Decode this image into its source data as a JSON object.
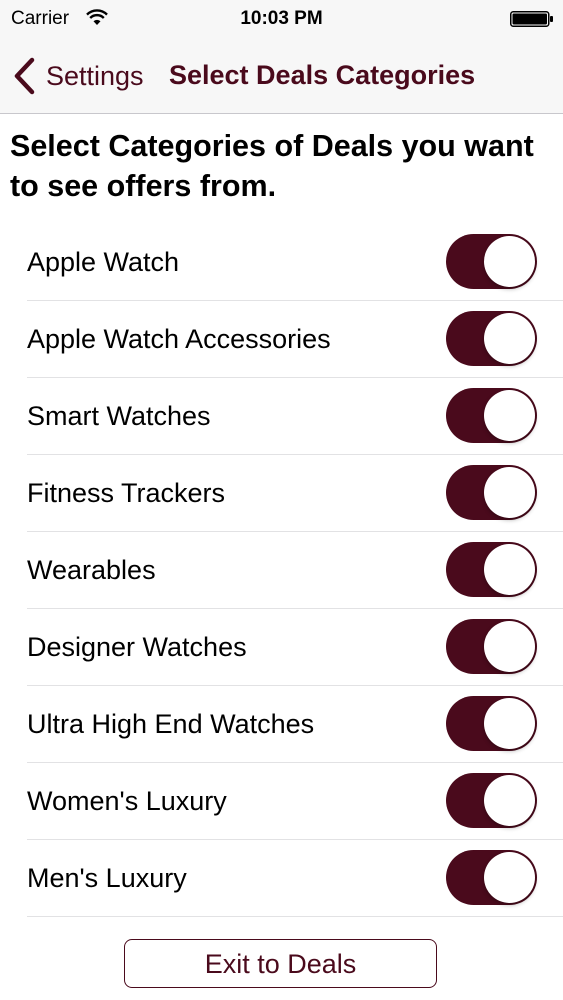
{
  "status_bar": {
    "carrier": "Carrier",
    "time": "10:03 PM",
    "wifi_icon": "wifi-icon",
    "battery_icon": "battery-icon"
  },
  "nav": {
    "back_label": "Settings",
    "back_icon": "chevron-left-icon",
    "title": "Select Deals Categories"
  },
  "heading": "Select Categories of Deals you want to see offers from.",
  "categories": [
    {
      "label": "Apple Watch",
      "enabled": true
    },
    {
      "label": "Apple Watch Accessories",
      "enabled": true
    },
    {
      "label": "Smart Watches",
      "enabled": true
    },
    {
      "label": "Fitness Trackers",
      "enabled": true
    },
    {
      "label": "Wearables",
      "enabled": true
    },
    {
      "label": "Designer Watches",
      "enabled": true
    },
    {
      "label": "Ultra High End Watches",
      "enabled": true
    },
    {
      "label": "Women's Luxury",
      "enabled": true
    },
    {
      "label": "Men's Luxury",
      "enabled": true
    }
  ],
  "exit_button_label": "Exit to Deals",
  "colors": {
    "accent": "#4a0a1c",
    "bar_background": "#f7f7f7",
    "divider": "#e2e2e4"
  }
}
